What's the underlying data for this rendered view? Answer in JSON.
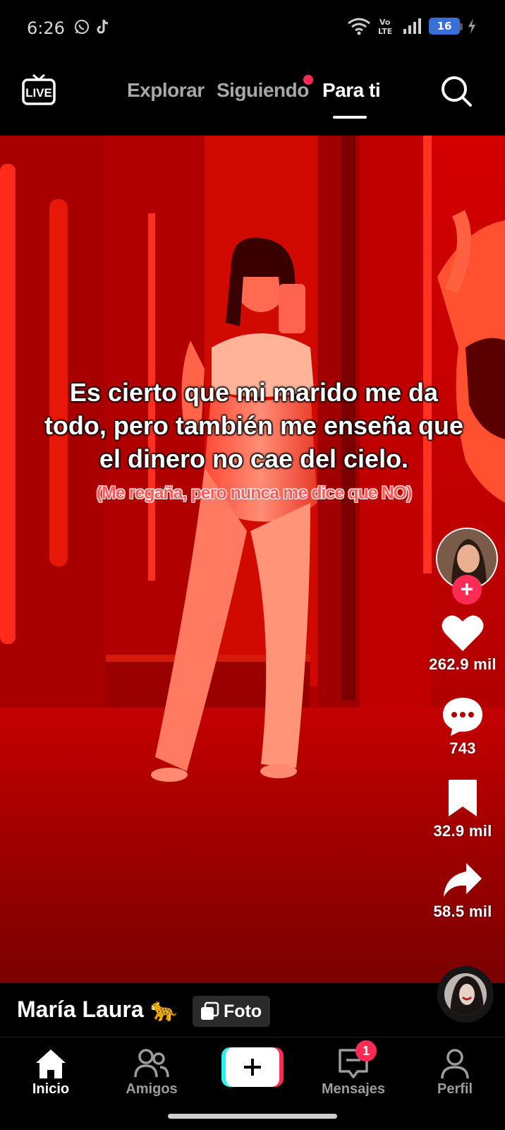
{
  "status_bar": {
    "time": "6:26",
    "network_label": "Vo LTE",
    "battery_level": "16"
  },
  "top_nav": {
    "live_label": "LIVE",
    "tabs": [
      {
        "label": "Explorar",
        "active": false
      },
      {
        "label": "Siguiendo",
        "active": false,
        "has_notification_dot": true
      },
      {
        "label": "Para ti",
        "active": true
      }
    ]
  },
  "post": {
    "caption_main": "Es cierto que mi marido me da todo, pero también me enseña que el dinero no cae del cielo.",
    "caption_sub": "(Me regaña, pero nunca me dice que NO)",
    "author_name": "María Laura 🐆",
    "content_type_label": "Foto",
    "actions": {
      "likes": "262.9 mil",
      "comments": "743",
      "saves": "32.9 mil",
      "shares": "58.5 mil"
    }
  },
  "bottom_nav": {
    "items": [
      {
        "label": "Inicio",
        "icon": "home-icon",
        "active": true
      },
      {
        "label": "Amigos",
        "icon": "friends-icon",
        "active": false
      },
      {
        "label": "Mensajes",
        "icon": "inbox-icon",
        "active": false,
        "badge": "1"
      },
      {
        "label": "Perfil",
        "icon": "profile-icon",
        "active": false
      }
    ]
  },
  "colors": {
    "accent": "#fe2c55",
    "secondary_accent": "#25f4ee",
    "video_tint": "#c80000",
    "caption_sub_text": "#ff5a5a"
  }
}
